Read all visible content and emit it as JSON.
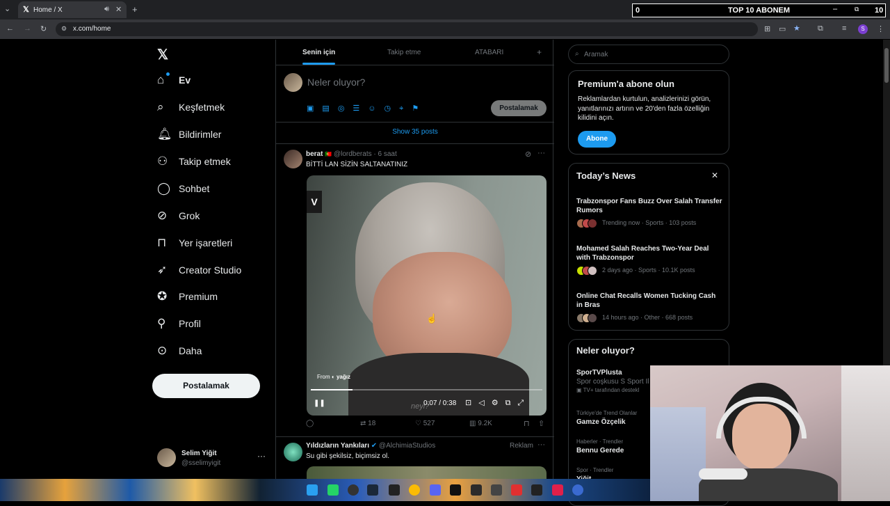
{
  "browser": {
    "tab_title": "Home / X",
    "url": "x.com/home"
  },
  "overlay": {
    "left": "0",
    "title": "TOP 10 ABONEM",
    "right": "10"
  },
  "nav": {
    "items": [
      {
        "label": "Ev",
        "icon": "home-icon"
      },
      {
        "label": "Keşfetmek",
        "icon": "search-icon"
      },
      {
        "label": "Bildirimler",
        "icon": "bell-icon"
      },
      {
        "label": "Takip etmek",
        "icon": "add-person-icon"
      },
      {
        "label": "Sohbet",
        "icon": "chat-icon"
      },
      {
        "label": "Grok",
        "icon": "grok-icon"
      },
      {
        "label": "Yer işaretleri",
        "icon": "bookmark-icon"
      },
      {
        "label": "Creator Studio",
        "icon": "rocket-icon"
      },
      {
        "label": "Premium",
        "icon": "verified-icon"
      },
      {
        "label": "Profil",
        "icon": "person-icon"
      },
      {
        "label": "Daha",
        "icon": "more-icon"
      }
    ],
    "post_button": "Postalamak",
    "account": {
      "name": "Selim Yiğit",
      "handle": "@sselimyigit"
    }
  },
  "tabs": [
    "Senin için",
    "Takip etme",
    "ATABARI"
  ],
  "composer": {
    "placeholder": "Neler oluyor?",
    "post_button": "Postalamak"
  },
  "show_posts": "Show 35 posts",
  "post1": {
    "author": "berat",
    "handle": "@lordberats",
    "time": "· 6 saat",
    "text": "BİTTİ LAN SİZİN SALTANATINIZ",
    "video_from": "From",
    "video_from_name": "yağız",
    "video_time": "0:07 / 0:38",
    "video_progress": 0.18,
    "video_badge": "V",
    "watermark": "neyi?",
    "replies": "",
    "reposts": "18",
    "likes": "527",
    "views": "9.2K"
  },
  "post2": {
    "author": "Yıldızların Yankıları",
    "handle": "@AlchimiaStudios",
    "ad_label": "Reklam",
    "text": "Su gibi şekilsiz, biçimsiz ol."
  },
  "search": {
    "placeholder": "Aramak"
  },
  "premium": {
    "title": "Premium'a abone olun",
    "text": "Reklamlardan kurtulun, analizlerinizi görün, yanıtlarınızı artırın ve 20'den fazla özelliğin kilidini açın.",
    "button": "Abone"
  },
  "news": {
    "title": "Today’s News",
    "items": [
      {
        "title": "Trabzonspor Fans Buzz Over Salah Transfer Rumors",
        "meta": "Trending now · Sports · 103 posts"
      },
      {
        "title": "Mohamed Salah Reaches Two-Year Deal with Trabzonspor",
        "meta": "2 days ago · Sports · 10.1K posts"
      },
      {
        "title": "Online Chat Recalls Women Tucking Cash in Bras",
        "meta": "14 hours ago · Other · 668 posts"
      }
    ]
  },
  "whats_happening": {
    "title": "Neler oluyor?",
    "items": [
      {
        "context": "",
        "name": "SporTVPlusta",
        "sub": "Spor coşkusu S Sport Il",
        "sub2": "TV+ tarafından destekl"
      },
      {
        "context": "Türkiye'de Trend Olanlar",
        "name": "Gamze Özçelik"
      },
      {
        "context": "Haberler · Trendler",
        "name": "Bennu Gerede"
      },
      {
        "context": "Spor · Trendler",
        "name": "Yiğit..."
      }
    ]
  },
  "colors": {
    "accent": "#1d9bf0",
    "background": "#000000",
    "border": "#2f3336"
  }
}
